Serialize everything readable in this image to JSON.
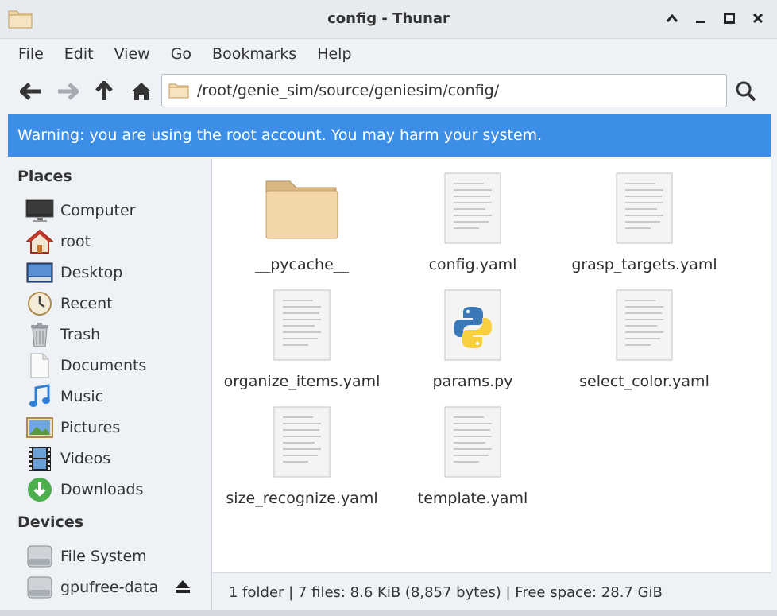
{
  "window": {
    "title": "config - Thunar",
    "controls": [
      "maximize-up",
      "minimize",
      "restore",
      "close"
    ]
  },
  "menubar": {
    "items": [
      "File",
      "Edit",
      "View",
      "Go",
      "Bookmarks",
      "Help"
    ]
  },
  "toolbar": {
    "back_icon": "back-arrow-icon",
    "forward_icon": "forward-arrow-icon",
    "up_icon": "up-arrow-icon",
    "home_icon": "home-icon",
    "location_path": "/root/genie_sim/source/geniesim/config/",
    "search_icon": "search-icon"
  },
  "warning": {
    "text": "Warning: you are using the root account. You may harm your system.",
    "color": "#3d8ee7"
  },
  "sidebar": {
    "places_title": "Places",
    "places": [
      {
        "label": "Computer",
        "icon": "monitor-icon"
      },
      {
        "label": "root",
        "icon": "home-icon"
      },
      {
        "label": "Desktop",
        "icon": "desktop-icon"
      },
      {
        "label": "Recent",
        "icon": "clock-icon"
      },
      {
        "label": "Trash",
        "icon": "trash-icon"
      },
      {
        "label": "Documents",
        "icon": "document-icon"
      },
      {
        "label": "Music",
        "icon": "music-icon"
      },
      {
        "label": "Pictures",
        "icon": "pictures-icon"
      },
      {
        "label": "Videos",
        "icon": "film-icon"
      },
      {
        "label": "Downloads",
        "icon": "download-icon"
      }
    ],
    "devices_title": "Devices",
    "devices": [
      {
        "label": "File System",
        "icon": "drive-icon"
      },
      {
        "label": "gpufree-data",
        "icon": "drive-icon",
        "ejectable": true
      }
    ]
  },
  "files": [
    {
      "name": "__pycache__",
      "type": "folder"
    },
    {
      "name": "config.yaml",
      "type": "text"
    },
    {
      "name": "grasp_targets.yaml",
      "type": "text"
    },
    {
      "name": "organize_items.yaml",
      "type": "text"
    },
    {
      "name": "params.py",
      "type": "python"
    },
    {
      "name": "select_color.yaml",
      "type": "text"
    },
    {
      "name": "size_recognize.yaml",
      "type": "text"
    },
    {
      "name": "template.yaml",
      "type": "text"
    }
  ],
  "statusbar": {
    "text": "1 folder  |  7 files: 8.6 KiB (8,857 bytes)  |  Free space: 28.7 GiB"
  }
}
